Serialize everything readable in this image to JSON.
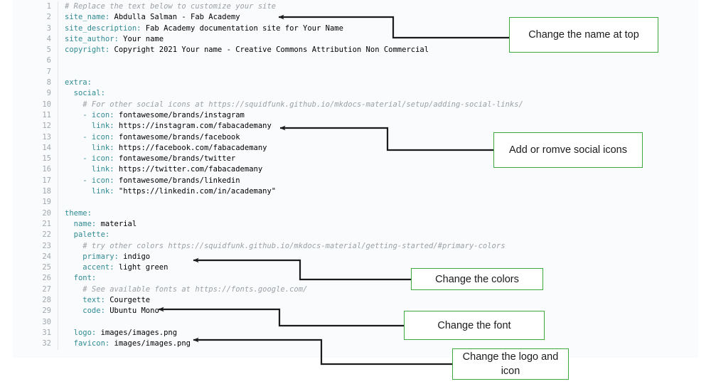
{
  "editor": {
    "language": "yaml",
    "first_line": 1,
    "last_line": 32,
    "colors": {
      "background": "#fafbfc",
      "gutter_text": "#a0a7ad",
      "comment": "#9aa0a6",
      "key": "#2f8a93",
      "value": "#f1698e",
      "annotation_border": "#3ba93b",
      "leader_line": "#1b1b1b"
    },
    "lines": [
      {
        "n": "1",
        "segments": [
          {
            "t": "comment",
            "s": "# Replace the text below to customize your site"
          }
        ]
      },
      {
        "n": "2",
        "segments": [
          {
            "t": "key",
            "s": "site_name:"
          },
          {
            "t": "value",
            "s": " Abdulla Salman - Fab Academy"
          }
        ]
      },
      {
        "n": "3",
        "segments": [
          {
            "t": "key",
            "s": "site_description:"
          },
          {
            "t": "value",
            "s": " Fab Academy documentation site for Your Name"
          }
        ]
      },
      {
        "n": "4",
        "segments": [
          {
            "t": "key",
            "s": "site_author:"
          },
          {
            "t": "value",
            "s": " Your name"
          }
        ]
      },
      {
        "n": "5",
        "segments": [
          {
            "t": "key",
            "s": "copyright:"
          },
          {
            "t": "value",
            "s": " Copyright 2021 Your name - Creative Commons Attribution Non Commercial"
          }
        ]
      },
      {
        "n": "6",
        "segments": [
          {
            "t": "plain",
            "s": ""
          }
        ]
      },
      {
        "n": "7",
        "segments": [
          {
            "t": "plain",
            "s": ""
          }
        ]
      },
      {
        "n": "8",
        "segments": [
          {
            "t": "key",
            "s": "extra:"
          }
        ]
      },
      {
        "n": "9",
        "segments": [
          {
            "t": "key",
            "s": "  social:"
          }
        ]
      },
      {
        "n": "10",
        "segments": [
          {
            "t": "comment",
            "s": "    # For other social icons at https://squidfunk.github.io/mkdocs-material/setup/adding-social-links/"
          }
        ]
      },
      {
        "n": "11",
        "segments": [
          {
            "t": "dash",
            "s": "    - icon:"
          },
          {
            "t": "value",
            "s": " fontawesome/brands/instagram"
          }
        ]
      },
      {
        "n": "12",
        "segments": [
          {
            "t": "key",
            "s": "      link:"
          },
          {
            "t": "value",
            "s": " https://instagram.com/fabacademany"
          }
        ]
      },
      {
        "n": "13",
        "segments": [
          {
            "t": "dash",
            "s": "    - icon:"
          },
          {
            "t": "value",
            "s": " fontawesome/brands/facebook"
          }
        ]
      },
      {
        "n": "14",
        "segments": [
          {
            "t": "key",
            "s": "      link:"
          },
          {
            "t": "value",
            "s": " https://facebook.com/fabacademany"
          }
        ]
      },
      {
        "n": "15",
        "segments": [
          {
            "t": "dash",
            "s": "    - icon:"
          },
          {
            "t": "value",
            "s": " fontawesome/brands/twitter"
          }
        ]
      },
      {
        "n": "16",
        "segments": [
          {
            "t": "key",
            "s": "      link:"
          },
          {
            "t": "value",
            "s": " https://twitter.com/fabacademany"
          }
        ]
      },
      {
        "n": "17",
        "segments": [
          {
            "t": "dash",
            "s": "    - icon:"
          },
          {
            "t": "value",
            "s": " fontawesome/brands/linkedin"
          }
        ]
      },
      {
        "n": "18",
        "segments": [
          {
            "t": "key",
            "s": "      link:"
          },
          {
            "t": "value",
            "s": " \"https://linkedin.com/in/academany\""
          }
        ]
      },
      {
        "n": "19",
        "segments": [
          {
            "t": "plain",
            "s": ""
          }
        ]
      },
      {
        "n": "20",
        "segments": [
          {
            "t": "key",
            "s": "theme:"
          }
        ]
      },
      {
        "n": "21",
        "segments": [
          {
            "t": "key",
            "s": "  name:"
          },
          {
            "t": "value",
            "s": " material"
          }
        ]
      },
      {
        "n": "22",
        "segments": [
          {
            "t": "key",
            "s": "  palette:"
          }
        ]
      },
      {
        "n": "23",
        "segments": [
          {
            "t": "comment",
            "s": "    # try other colors https://squidfunk.github.io/mkdocs-material/getting-started/#primary-colors"
          }
        ]
      },
      {
        "n": "24",
        "segments": [
          {
            "t": "key",
            "s": "    primary:"
          },
          {
            "t": "value",
            "s": " indigo"
          }
        ]
      },
      {
        "n": "25",
        "segments": [
          {
            "t": "key",
            "s": "    accent:"
          },
          {
            "t": "value",
            "s": " light green"
          }
        ]
      },
      {
        "n": "26",
        "segments": [
          {
            "t": "key",
            "s": "  font:"
          }
        ]
      },
      {
        "n": "27",
        "segments": [
          {
            "t": "comment",
            "s": "    # See available fonts at https://fonts.google.com/"
          }
        ]
      },
      {
        "n": "28",
        "segments": [
          {
            "t": "key",
            "s": "    text:"
          },
          {
            "t": "value",
            "s": " Courgette"
          }
        ]
      },
      {
        "n": "29",
        "segments": [
          {
            "t": "key",
            "s": "    code:"
          },
          {
            "t": "value",
            "s": " Ubuntu Mono"
          }
        ]
      },
      {
        "n": "30",
        "segments": [
          {
            "t": "plain",
            "s": ""
          }
        ]
      },
      {
        "n": "31",
        "segments": [
          {
            "t": "key",
            "s": "  logo:"
          },
          {
            "t": "value",
            "s": " images/images.png"
          }
        ]
      },
      {
        "n": "32",
        "segments": [
          {
            "t": "key",
            "s": "  favicon:"
          },
          {
            "t": "value",
            "s": " images/images.png"
          }
        ]
      }
    ]
  },
  "annotations": [
    {
      "id": "name",
      "label": "Change the name at top"
    },
    {
      "id": "social",
      "label": "Add or romve  social icons"
    },
    {
      "id": "colors",
      "label": "Change  the colors"
    },
    {
      "id": "font",
      "label": "Change the font"
    },
    {
      "id": "logo",
      "label": "Change the logo and icon"
    }
  ]
}
